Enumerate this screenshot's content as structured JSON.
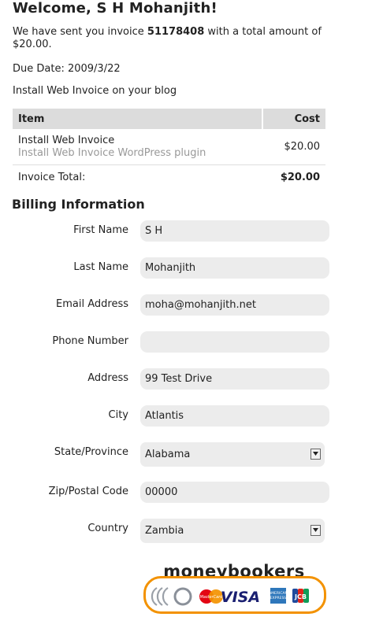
{
  "welcome": "Welcome, S H Mohanjith!",
  "invoice_msg": {
    "prefix": "We have sent you invoice",
    "number": "51178408",
    "suffix": "with a total amount of $20.00."
  },
  "due_date": "Due Date: 2009/3/22",
  "invoice_subject": "Install Web Invoice on your blog",
  "table": {
    "headers": {
      "item": "Item",
      "cost": "Cost"
    },
    "row": {
      "name": "Install Web Invoice",
      "description": "Install Web Invoice WordPress plugin",
      "cost": "$20.00"
    },
    "total_label": "Invoice Total:",
    "total_value": "$20.00"
  },
  "billing_title": "Billing Information",
  "fields": {
    "first_name": {
      "label": "First Name",
      "value": "S H"
    },
    "last_name": {
      "label": "Last Name",
      "value": "Mohanjith"
    },
    "email": {
      "label": "Email Address",
      "value": "moha@mohanjith.net"
    },
    "phone": {
      "label": "Phone Number",
      "value": ""
    },
    "address": {
      "label": "Address",
      "value": "99 Test Drive"
    },
    "city": {
      "label": "City",
      "value": "Atlantis"
    },
    "state": {
      "label": "State/Province",
      "value": "Alabama"
    },
    "zip": {
      "label": "Zip/Postal Code",
      "value": "00000"
    },
    "country": {
      "label": "Country",
      "value": "Zambia"
    }
  },
  "payment": {
    "brand": "moneybookers",
    "cards": [
      "MasterCard",
      "VISA",
      "American Express",
      "JCB"
    ],
    "accent": "#f39200"
  }
}
